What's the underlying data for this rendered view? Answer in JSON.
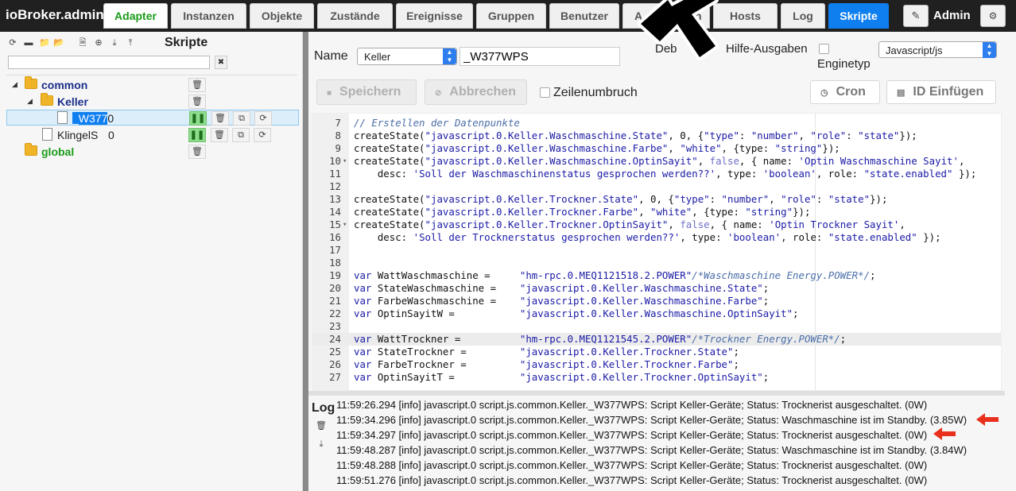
{
  "app": {
    "title": "ioBroker.admin"
  },
  "tabs": [
    {
      "label": "Adapter"
    },
    {
      "label": "Instanzen"
    },
    {
      "label": "Objekte"
    },
    {
      "label": "Zustände"
    },
    {
      "label": "Ereignisse"
    },
    {
      "label": "Gruppen"
    },
    {
      "label": "Benutzer"
    },
    {
      "label": "A"
    },
    {
      "label": "n"
    },
    {
      "label": "Hosts"
    },
    {
      "label": "Log"
    },
    {
      "label": "Skripte"
    }
  ],
  "user": {
    "name": "Admin"
  },
  "tree": {
    "title": "Skripte",
    "search_value": "",
    "nodes": [
      {
        "label": "common"
      },
      {
        "label": "Keller"
      },
      {
        "label_hl": "_W377",
        "label_rest": "0"
      },
      {
        "label": "KlingelS",
        "suffix": "0"
      },
      {
        "label": "global"
      }
    ]
  },
  "editor": {
    "name_label": "Name",
    "folder_value": "Keller",
    "script_name": "_W377WPS",
    "debug_label": "Deb",
    "help_label": "Hilfe-Ausgaben",
    "engine_label": "Enginetyp",
    "engine_value": "Javascript/js",
    "save_label": "Speichern",
    "cancel_label": "Abbrechen",
    "wrap_label": "Zeilenumbruch",
    "cron_label": "Cron",
    "id_label": "ID Einfügen",
    "active_line": 24
  },
  "code_lines": [
    {
      "n": "7",
      "t": "// Erstellen der Datenpunkte"
    },
    {
      "n": "8",
      "t": "createState(\"javascript.0.Keller.Waschmaschine.State\", 0, {\"type\": \"number\", \"role\": \"state\"});"
    },
    {
      "n": "9",
      "t": "createState(\"javascript.0.Keller.Waschmaschine.Farbe\", \"white\", {type: \"string\"});"
    },
    {
      "n": "10",
      "t": "createState(\"javascript.0.Keller.Waschmaschine.OptinSayit\", false, { name: 'Optin Waschmaschine Sayit',",
      "fold": true
    },
    {
      "n": "11",
      "t": "    desc: 'Soll der Waschmaschinenstatus gesprochen werden??', type: 'boolean', role: \"state.enabled\" });"
    },
    {
      "n": "12",
      "t": ""
    },
    {
      "n": "13",
      "t": "createState(\"javascript.0.Keller.Trockner.State\", 0, {\"type\": \"number\", \"role\": \"state\"});"
    },
    {
      "n": "14",
      "t": "createState(\"javascript.0.Keller.Trockner.Farbe\", \"white\", {type: \"string\"});"
    },
    {
      "n": "15",
      "t": "createState(\"javascript.0.Keller.Trockner.OptinSayit\", false, { name: 'Optin Trockner Sayit',",
      "fold": true
    },
    {
      "n": "16",
      "t": "    desc: 'Soll der Trocknerstatus gesprochen werden??', type: 'boolean', role: \"state.enabled\" });"
    },
    {
      "n": "17",
      "t": ""
    },
    {
      "n": "18",
      "t": ""
    },
    {
      "n": "19",
      "t": "var WattWaschmaschine =     \"hm-rpc.0.MEQ1121518.2.POWER\"/*Waschmaschine Energy.POWER*/;"
    },
    {
      "n": "20",
      "t": "var StateWaschmaschine =    \"javascript.0.Keller.Waschmaschine.State\";"
    },
    {
      "n": "21",
      "t": "var FarbeWaschmaschine =    \"javascript.0.Keller.Waschmaschine.Farbe\";"
    },
    {
      "n": "22",
      "t": "var OptinSayitW =           \"javascript.0.Keller.Waschmaschine.OptinSayit\";"
    },
    {
      "n": "23",
      "t": ""
    },
    {
      "n": "24",
      "t": "var WattTrockner =          \"hm-rpc.0.MEQ1121545.2.POWER\"/*Trockner Energy.POWER*/;"
    },
    {
      "n": "25",
      "t": "var StateTrockner =         \"javascript.0.Keller.Trockner.State\";"
    },
    {
      "n": "26",
      "t": "var FarbeTrockner =         \"javascript.0.Keller.Trockner.Farbe\";"
    },
    {
      "n": "27",
      "t": "var OptinSayitT =           \"javascript.0.Keller.Trockner.OptinSayit\";"
    }
  ],
  "log": {
    "title": "Log",
    "lines": [
      "11:59:26.294  [info]  javascript.0 script.js.common.Keller._W377WPS: Script Keller-Geräte; Status: Trocknerist ausgeschaltet. (0W)",
      "11:59:34.296  [info]  javascript.0 script.js.common.Keller._W377WPS: Script Keller-Geräte; Status: Waschmaschine ist im Standby. (3.85W)",
      "11:59:34.297  [info]  javascript.0 script.js.common.Keller._W377WPS: Script Keller-Geräte; Status: Trocknerist ausgeschaltet. (0W)",
      "11:59:48.287  [info]  javascript.0 script.js.common.Keller._W377WPS: Script Keller-Geräte; Status: Waschmaschine ist im Standby. (3.84W)",
      "11:59:48.288  [info]  javascript.0 script.js.common.Keller._W377WPS: Script Keller-Geräte; Status: Trocknerist ausgeschaltet. (0W)",
      "11:59:51.276  [info]  javascript.0 script.js.common.Keller._W377WPS: Script Keller-Geräte; Status: Trocknerist ausgeschaltet. (0W)"
    ]
  },
  "colors": {
    "accent": "#0f7ff0",
    "active_tab_green": "#1a9b1a",
    "annotation_arrow": "#e8301c"
  },
  "icons": [
    "refresh-icon",
    "minus-icon",
    "folder-icon",
    "folder-open-icon",
    "file-icon",
    "plus-circle-icon",
    "download-icon",
    "upload-icon",
    "trash-icon",
    "pause-icon",
    "copy-icon",
    "restart-icon",
    "pencil-icon",
    "gear-icon",
    "clock-icon"
  ]
}
